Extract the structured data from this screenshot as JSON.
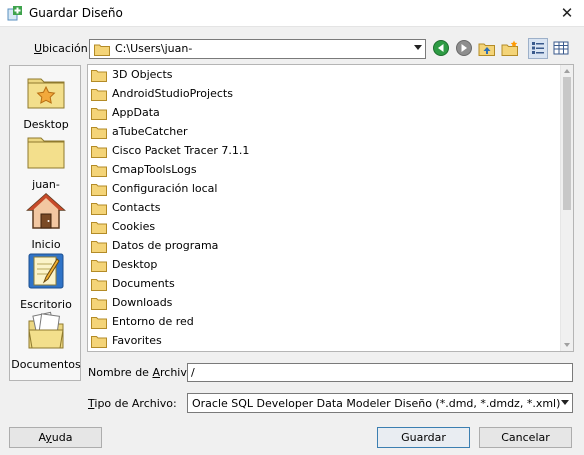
{
  "window": {
    "title": "Guardar Diseño",
    "close_glyph": "✕",
    "icon": "plus-document-icon"
  },
  "location": {
    "label_mnemonic": "U",
    "label_rest": "bicación:",
    "path": "C:\\Users\\juan-"
  },
  "toolbar": {
    "buttons": [
      "back-icon",
      "forward-icon",
      "up-folder-icon",
      "new-folder-icon",
      "list-view-icon",
      "details-view-icon"
    ]
  },
  "places": [
    {
      "label": "Desktop",
      "icon": "desktop-folder-icon"
    },
    {
      "label": "juan-",
      "icon": "user-folder-icon"
    },
    {
      "label": "Inicio",
      "icon": "home-icon"
    },
    {
      "label": "Escritorio",
      "icon": "notepad-icon"
    },
    {
      "label": "Documentos",
      "icon": "documents-folder-icon"
    }
  ],
  "files": [
    "3D Objects",
    "AndroidStudioProjects",
    "AppData",
    "aTubeCatcher",
    "Cisco Packet Tracer 7.1.1",
    "CmapToolsLogs",
    "Configuración local",
    "Contacts",
    "Cookies",
    "Datos de programa",
    "Desktop",
    "Documents",
    "Downloads",
    "Entorno de red",
    "Favorites"
  ],
  "filename": {
    "label_pre": "Nombre de ",
    "label_mnemonic": "A",
    "label_post": "rchivo:",
    "value": "/"
  },
  "filetype": {
    "label_mnemonic": "T",
    "label_rest": "ipo de Archivo:",
    "value": "Oracle SQL Developer Data Modeler Diseño (*.dmd, *.dmdz, *.xml)"
  },
  "buttons": {
    "help_pre": "A",
    "help_mnemonic": "y",
    "help_post": "uda",
    "save": "Guardar",
    "cancel": "Cancelar"
  },
  "colors": {
    "accent": "#3c7fb1",
    "folder_yellow": "#e8c65a"
  }
}
